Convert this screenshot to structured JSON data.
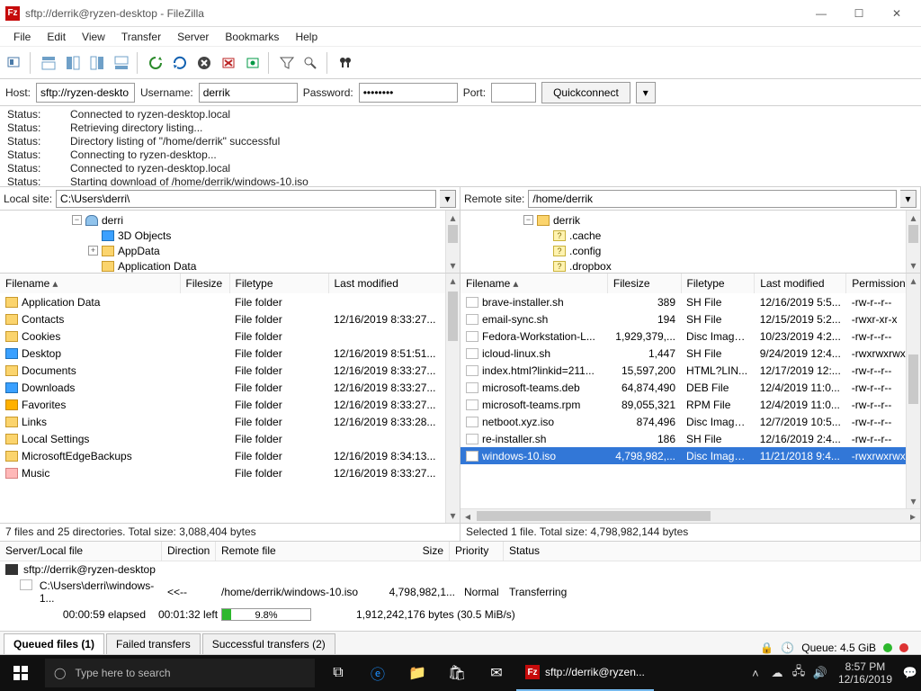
{
  "window": {
    "title": "sftp://derrik@ryzen-desktop - FileZilla",
    "app_short": "Fz"
  },
  "menu": [
    "File",
    "Edit",
    "View",
    "Transfer",
    "Server",
    "Bookmarks",
    "Help"
  ],
  "quickconnect": {
    "host_label": "Host:",
    "host_value": "sftp://ryzen-deskto",
    "user_label": "Username:",
    "user_value": "derrik",
    "pass_label": "Password:",
    "pass_value": "••••••••",
    "port_label": "Port:",
    "port_value": "",
    "button": "Quickconnect"
  },
  "log": [
    {
      "label": "Status:",
      "msg": "Connected to ryzen-desktop.local"
    },
    {
      "label": "Status:",
      "msg": "Retrieving directory listing..."
    },
    {
      "label": "Status:",
      "msg": "Directory listing of \"/home/derrik\" successful"
    },
    {
      "label": "Status:",
      "msg": "Connecting to ryzen-desktop..."
    },
    {
      "label": "Status:",
      "msg": "Connected to ryzen-desktop.local"
    },
    {
      "label": "Status:",
      "msg": "Starting download of /home/derrik/windows-10.iso"
    }
  ],
  "local_site_label": "Local site:",
  "local_site_path": "C:\\Users\\derri\\",
  "remote_site_label": "Remote site:",
  "remote_site_path": "/home/derrik",
  "local_tree": [
    "derri",
    "3D Objects",
    "AppData",
    "Application Data"
  ],
  "remote_tree": [
    "derrik",
    ".cache",
    ".config",
    ".dropbox"
  ],
  "local_columns": [
    "Filename",
    "Filesize",
    "Filetype",
    "Last modified"
  ],
  "remote_columns": [
    "Filename",
    "Filesize",
    "Filetype",
    "Last modified",
    "Permissions"
  ],
  "local_files": [
    {
      "name": "Application Data",
      "size": "",
      "type": "File folder",
      "mod": "",
      "ic": "folder"
    },
    {
      "name": "Contacts",
      "size": "",
      "type": "File folder",
      "mod": "12/16/2019 8:33:27...",
      "ic": "folder"
    },
    {
      "name": "Cookies",
      "size": "",
      "type": "File folder",
      "mod": "",
      "ic": "folder"
    },
    {
      "name": "Desktop",
      "size": "",
      "type": "File folder",
      "mod": "12/16/2019 8:51:51...",
      "ic": "blue"
    },
    {
      "name": "Documents",
      "size": "",
      "type": "File folder",
      "mod": "12/16/2019 8:33:27...",
      "ic": "folder"
    },
    {
      "name": "Downloads",
      "size": "",
      "type": "File folder",
      "mod": "12/16/2019 8:33:27...",
      "ic": "dl"
    },
    {
      "name": "Favorites",
      "size": "",
      "type": "File folder",
      "mod": "12/16/2019 8:33:27...",
      "ic": "star"
    },
    {
      "name": "Links",
      "size": "",
      "type": "File folder",
      "mod": "12/16/2019 8:33:28...",
      "ic": "folder"
    },
    {
      "name": "Local Settings",
      "size": "",
      "type": "File folder",
      "mod": "",
      "ic": "folder"
    },
    {
      "name": "MicrosoftEdgeBackups",
      "size": "",
      "type": "File folder",
      "mod": "12/16/2019 8:34:13...",
      "ic": "folder"
    },
    {
      "name": "Music",
      "size": "",
      "type": "File folder",
      "mod": "12/16/2019 8:33:27...",
      "ic": "music"
    }
  ],
  "local_status": "7 files and 25 directories. Total size: 3,088,404 bytes",
  "remote_files": [
    {
      "name": "brave-installer.sh",
      "size": "389",
      "type": "SH File",
      "mod": "12/16/2019 5:5...",
      "perm": "-rw-r--r--",
      "sel": false
    },
    {
      "name": "email-sync.sh",
      "size": "194",
      "type": "SH File",
      "mod": "12/15/2019 5:2...",
      "perm": "-rwxr-xr-x",
      "sel": false
    },
    {
      "name": "Fedora-Workstation-L...",
      "size": "1,929,379,...",
      "type": "Disc Image...",
      "mod": "10/23/2019 4:2...",
      "perm": "-rw-r--r--",
      "sel": false
    },
    {
      "name": "icloud-linux.sh",
      "size": "1,447",
      "type": "SH File",
      "mod": "9/24/2019 12:4...",
      "perm": "-rwxrwxrwx",
      "sel": false
    },
    {
      "name": "index.html?linkid=211...",
      "size": "15,597,200",
      "type": "HTML?LIN...",
      "mod": "12/17/2019 12:...",
      "perm": "-rw-r--r--",
      "sel": false
    },
    {
      "name": "microsoft-teams.deb",
      "size": "64,874,490",
      "type": "DEB File",
      "mod": "12/4/2019 11:0...",
      "perm": "-rw-r--r--",
      "sel": false
    },
    {
      "name": "microsoft-teams.rpm",
      "size": "89,055,321",
      "type": "RPM File",
      "mod": "12/4/2019 11:0...",
      "perm": "-rw-r--r--",
      "sel": false
    },
    {
      "name": "netboot.xyz.iso",
      "size": "874,496",
      "type": "Disc Image...",
      "mod": "12/7/2019 10:5...",
      "perm": "-rw-r--r--",
      "sel": false
    },
    {
      "name": "re-installer.sh",
      "size": "186",
      "type": "SH File",
      "mod": "12/16/2019 2:4...",
      "perm": "-rw-r--r--",
      "sel": false
    },
    {
      "name": "windows-10.iso",
      "size": "4,798,982,...",
      "type": "Disc Image...",
      "mod": "11/21/2018 9:4...",
      "perm": "-rwxrwxrwx",
      "sel": true
    }
  ],
  "remote_status": "Selected 1 file. Total size: 4,798,982,144 bytes",
  "queue_columns": [
    "Server/Local file",
    "Direction",
    "Remote file",
    "Size",
    "Priority",
    "Status"
  ],
  "queue_server": "sftp://derrik@ryzen-desktop",
  "queue_item": {
    "local": "C:\\Users\\derri\\windows-1...",
    "dir": "<<--",
    "remote": "/home/derrik/windows-10.iso",
    "size": "4,798,982,1...",
    "priority": "Normal",
    "status": "Transferring",
    "elapsed": "00:00:59 elapsed",
    "left": "00:01:32 left",
    "pct": "9.8%",
    "pct_num": 9.8,
    "bytes": "1,912,242,176 bytes (30.5 MiB/s)"
  },
  "queue_tabs": {
    "queued": "Queued files (1)",
    "failed": "Failed transfers",
    "success": "Successful transfers (2)"
  },
  "footer": {
    "queue_label": "Queue: 4.5 GiB"
  },
  "taskbar": {
    "search_placeholder": "Type here to search",
    "active_app": "sftp://derrik@ryzen...",
    "time": "8:57 PM",
    "date": "12/16/2019"
  }
}
